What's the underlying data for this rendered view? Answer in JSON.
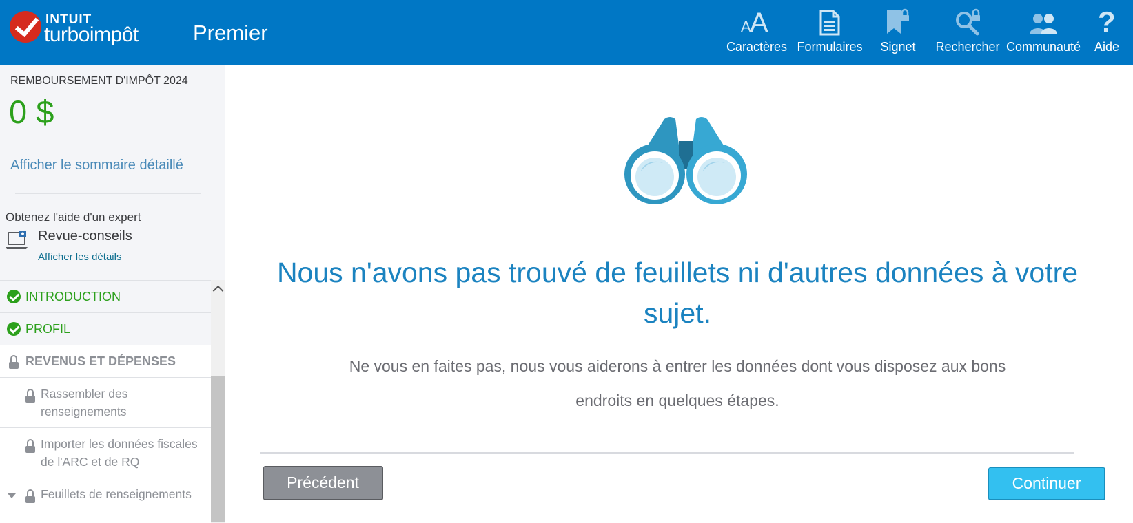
{
  "header": {
    "brand_top": "INTUIT",
    "brand_name": "turboimpôt",
    "product": "Premier",
    "tools": [
      {
        "icon": "font-size-icon",
        "label": "Caractères"
      },
      {
        "icon": "forms-icon",
        "label": "Formulaires"
      },
      {
        "icon": "bookmark-icon",
        "label": "Signet"
      },
      {
        "icon": "search-icon",
        "label": "Rechercher"
      },
      {
        "icon": "community-icon",
        "label": "Communauté"
      },
      {
        "icon": "help-icon",
        "label": "Aide"
      }
    ]
  },
  "sidebar": {
    "refund_label": "REMBOURSEMENT D'IMPÔT 2024",
    "refund_amount": "0 $",
    "summary_link": "Afficher le sommaire détaillé",
    "expert": {
      "title": "Obtenez l'aide d'un expert",
      "name": "Revue-conseils",
      "link": "Afficher les détails"
    },
    "nav": [
      {
        "label": "INTRODUCTION",
        "state": "done"
      },
      {
        "label": "PROFIL",
        "state": "done"
      },
      {
        "label": "REVENUS ET DÉPENSES",
        "state": "locked"
      },
      {
        "label": "Rassembler des renseignements",
        "state": "locked"
      },
      {
        "label": "Importer les données fiscales de l'ARC et de RQ",
        "state": "locked"
      },
      {
        "label": "Feuillets de renseignements",
        "state": "locked"
      }
    ]
  },
  "main": {
    "headline": "Nous n'avons pas trouvé de feuillets ni d'autres données à votre sujet.",
    "subtext": "Ne vous en faites pas, nous vous aiderons à entrer les données dont vous disposez aux bons endroits en quelques étapes.",
    "prev_button": "Précédent",
    "next_button": "Continuer"
  },
  "colors": {
    "header_bg": "#0077c5",
    "accent_green": "#2ca01c",
    "headline_blue": "#1b83c0",
    "continue_button": "#33c0f0",
    "prev_button": "#8d9096"
  }
}
